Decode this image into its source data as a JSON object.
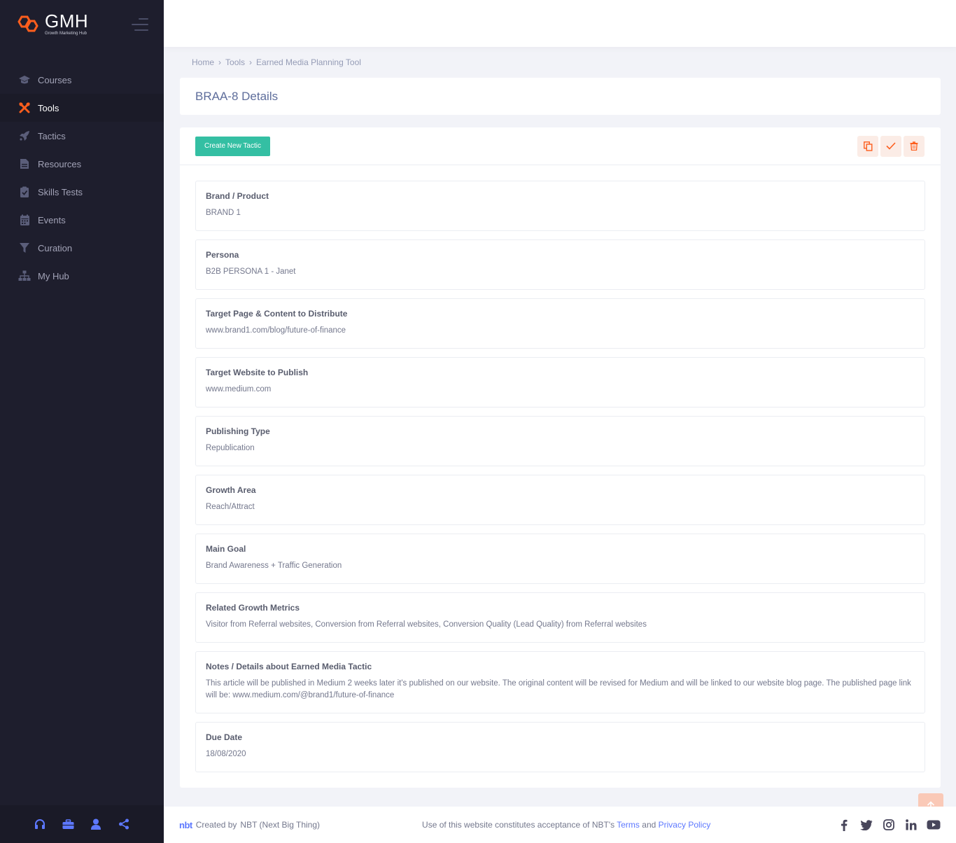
{
  "brand": {
    "name": "GMH",
    "tagline": "Growth Marketing Hub",
    "accent": "#fd5e1d"
  },
  "sidebar": {
    "items": [
      {
        "label": "Courses",
        "icon": "graduation-cap-icon"
      },
      {
        "label": "Tools",
        "icon": "tools-icon",
        "active": true
      },
      {
        "label": "Tactics",
        "icon": "rocket-icon"
      },
      {
        "label": "Resources",
        "icon": "document-icon"
      },
      {
        "label": "Skills Tests",
        "icon": "clipboard-check-icon"
      },
      {
        "label": "Events",
        "icon": "calendar-icon"
      },
      {
        "label": "Curation",
        "icon": "filter-icon"
      },
      {
        "label": "My Hub",
        "icon": "sitemap-icon"
      }
    ],
    "footer_icons": [
      "headset-icon",
      "briefcase-icon",
      "user-icon",
      "share-icon"
    ]
  },
  "breadcrumb": {
    "home": "Home",
    "tools": "Tools",
    "current": "Earned Media Planning Tool"
  },
  "page": {
    "title": "BRAA-8 Details"
  },
  "toolbar": {
    "create_label": "Create New Tactic",
    "action_icons": [
      "copy-icon",
      "check-icon",
      "trash-icon"
    ]
  },
  "fields": [
    {
      "label": "Brand / Product",
      "value": "BRAND 1"
    },
    {
      "label": "Persona",
      "value": "B2B PERSONA 1 - Janet"
    },
    {
      "label": "Target Page & Content to Distribute",
      "value": "www.brand1.com/blog/future-of-finance"
    },
    {
      "label": "Target Website to Publish",
      "value": "www.medium.com"
    },
    {
      "label": "Publishing Type",
      "value": "Republication"
    },
    {
      "label": "Growth Area",
      "value": "Reach/Attract"
    },
    {
      "label": "Main Goal",
      "value": "Brand Awareness + Traffic Generation"
    },
    {
      "label": "Related Growth Metrics",
      "value": "Visitor from Referral websites, Conversion from Referral websites, Conversion Quality (Lead Quality) from Referral websites"
    },
    {
      "label": "Notes / Details about Earned Media Tactic",
      "value": "This article will be published in Medium 2 weeks later it's published on our website. The original content will be revised for Medium and will be linked to our website blog page. The published page link will be: www.medium.com/@brand1/future-of-finance"
    },
    {
      "label": "Due Date",
      "value": "18/08/2020"
    }
  ],
  "footer": {
    "nbt_logo": "nbt",
    "created_by": "Created by",
    "company": "NBT (Next Big Thing)",
    "policy_prefix": "Use of this website constitutes acceptance of NBT's",
    "terms": "Terms",
    "and": "and",
    "privacy": "Privacy Policy",
    "socials": [
      "facebook-icon",
      "twitter-icon",
      "instagram-icon",
      "linkedin-icon",
      "youtube-icon"
    ]
  }
}
